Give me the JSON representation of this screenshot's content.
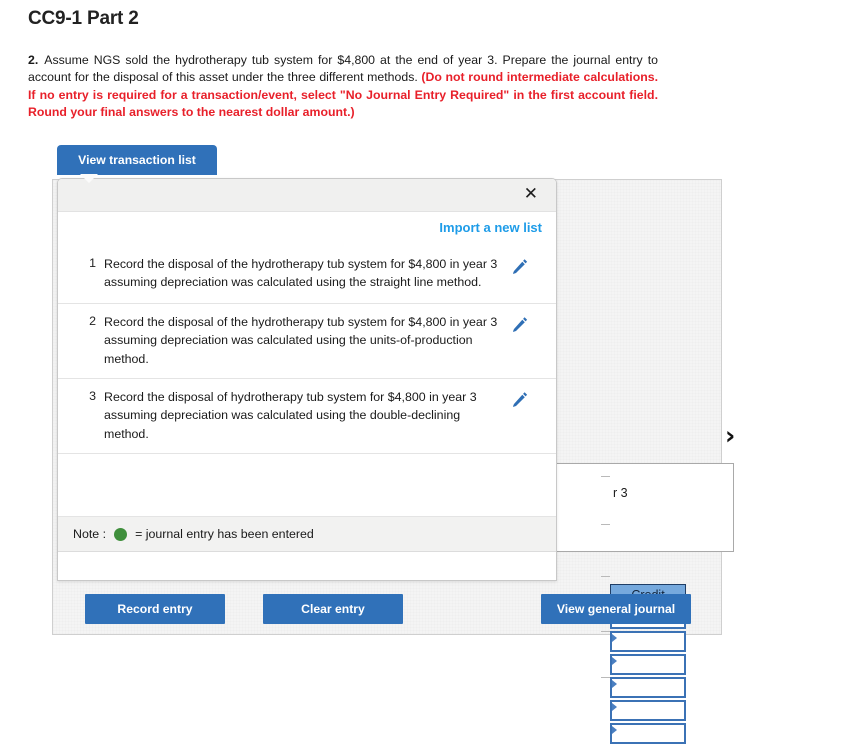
{
  "page": {
    "title": "CC9-1 Part 2"
  },
  "question": {
    "number": "2.",
    "text": "Assume NGS sold the hydrotherapy tub system for $4,800 at the end of year 3. Prepare the journal entry to account for the disposal of this asset under the three different methods. ",
    "red_text": "(Do not round intermediate calculations. If no entry is required for a transaction/event, select \"No Journal Entry Required\" in the first account field. Round your final answers to the nearest dollar amount.)",
    "red_color": "#e8202a"
  },
  "tab": {
    "label": "View transaction list",
    "color": "#3071b9"
  },
  "modal": {
    "close_label": "✕",
    "import_link": "Import a new list",
    "import_color": "#1e9ce8",
    "transactions": [
      {
        "num": "1",
        "text": "Record the disposal of the hydrotherapy tub system for $4,800 in year 3 assuming depreciation was calculated using the straight line method.",
        "edit_icon": "pencil-icon"
      },
      {
        "num": "2",
        "text": "Record the disposal of the hydrotherapy tub system for $4,800 in year 3 assuming depreciation was calculated using the units-of-production method.",
        "edit_icon": "pencil-icon"
      },
      {
        "num": "3",
        "text": "Record the disposal of hydrotherapy tub system for $4,800 in year 3 assuming depreciation was calculated using the double-declining method.",
        "edit_icon": "pencil-icon"
      }
    ],
    "note": {
      "label": "Note :",
      "dot_color": "#3f8f3c",
      "text": "= journal entry has been entered"
    }
  },
  "journal_background": {
    "chevron": "›",
    "partial_text": "r 3",
    "credit_header": "Credit",
    "credit_rows": 6
  },
  "footer": {
    "record_entry": "Record entry",
    "clear_entry": "Clear entry",
    "view_general_journal": "View general journal"
  }
}
